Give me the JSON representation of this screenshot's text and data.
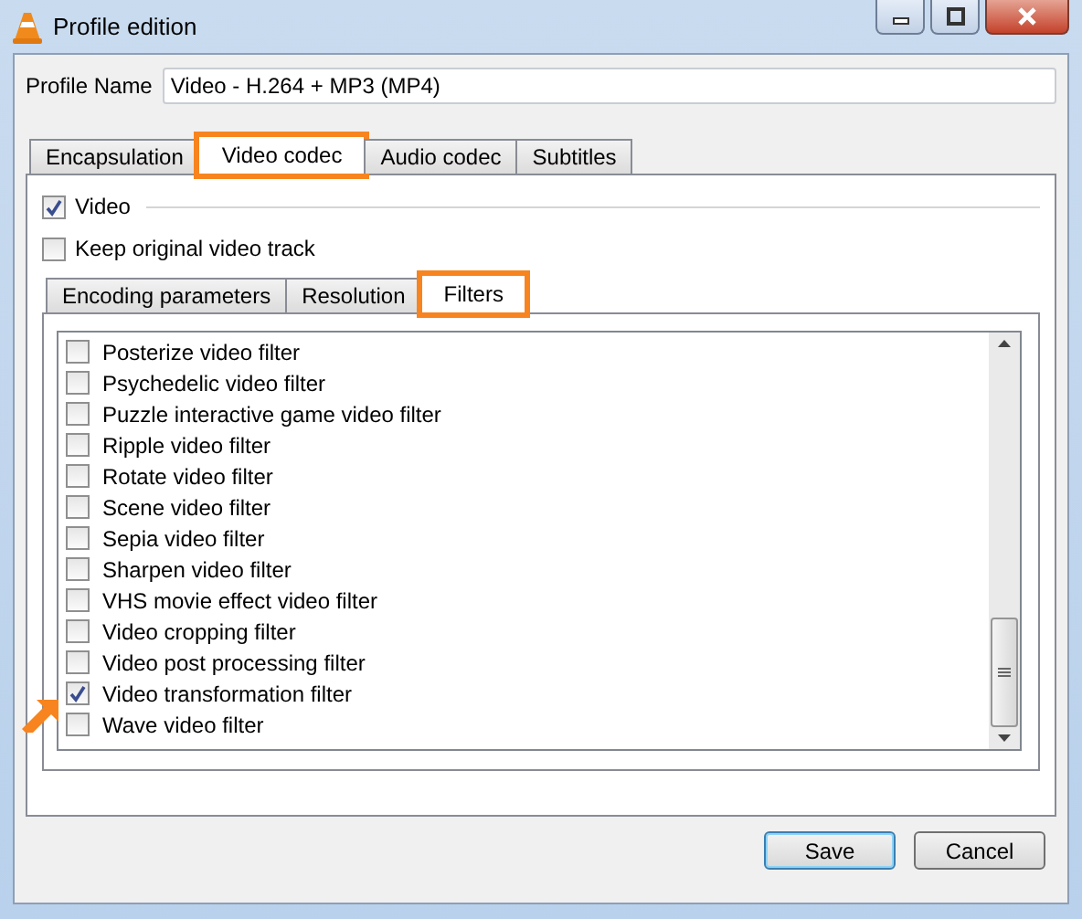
{
  "window": {
    "title": "Profile edition",
    "controls": [
      {
        "kind": "minimize"
      },
      {
        "kind": "maximize"
      },
      {
        "kind": "close"
      }
    ]
  },
  "profile_name": {
    "label": "Profile Name",
    "value": "Video - H.264 + MP3 (MP4)"
  },
  "tabs": [
    {
      "label": "Encapsulation",
      "selected": false,
      "highlighted": false
    },
    {
      "label": "Video codec",
      "selected": true,
      "highlighted": true
    },
    {
      "label": "Audio codec",
      "selected": false,
      "highlighted": false
    },
    {
      "label": "Subtitles",
      "selected": false,
      "highlighted": false
    }
  ],
  "video": {
    "label": "Video",
    "checked": true
  },
  "keep_original": {
    "label": "Keep original video track",
    "checked": false
  },
  "subtabs": [
    {
      "label": "Encoding parameters",
      "selected": false,
      "highlighted": false
    },
    {
      "label": "Resolution",
      "selected": false,
      "highlighted": false
    },
    {
      "label": "Filters",
      "selected": true,
      "highlighted": true
    }
  ],
  "filters": [
    {
      "label": "Posterize video filter",
      "checked": false,
      "pointed": false
    },
    {
      "label": "Psychedelic video filter",
      "checked": false,
      "pointed": false
    },
    {
      "label": "Puzzle interactive game video filter",
      "checked": false,
      "pointed": false
    },
    {
      "label": "Ripple video filter",
      "checked": false,
      "pointed": false
    },
    {
      "label": "Rotate video filter",
      "checked": false,
      "pointed": false
    },
    {
      "label": "Scene video filter",
      "checked": false,
      "pointed": false
    },
    {
      "label": "Sepia video filter",
      "checked": false,
      "pointed": false
    },
    {
      "label": "Sharpen video filter",
      "checked": false,
      "pointed": false
    },
    {
      "label": "VHS movie effect video filter",
      "checked": false,
      "pointed": false
    },
    {
      "label": "Video cropping filter",
      "checked": false,
      "pointed": false
    },
    {
      "label": "Video post processing filter",
      "checked": false,
      "pointed": false
    },
    {
      "label": "Video transformation filter",
      "checked": true,
      "pointed": true
    },
    {
      "label": "Wave video filter",
      "checked": false,
      "pointed": false
    }
  ],
  "buttons": [
    {
      "label": "Save",
      "default": true
    },
    {
      "label": "Cancel",
      "default": false
    }
  ]
}
